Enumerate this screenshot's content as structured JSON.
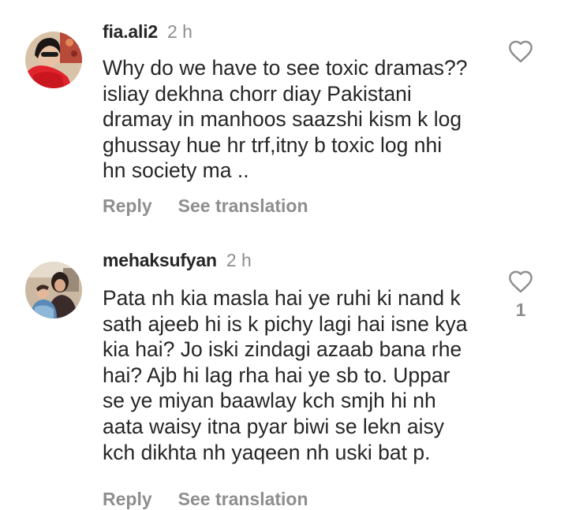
{
  "comments": [
    {
      "username": "fia.ali2",
      "time": "2 h",
      "lines": [
        "Why do we have to see toxic dramas??",
        "isliay dekhna chorr diay Pakistani",
        "dramay in manhoos saazshi kism k log",
        "ghussay hue hr trf,itny b toxic log nhi",
        "hn society ma .."
      ],
      "reply_label": "Reply",
      "translate_label": "See translation",
      "like_count": "",
      "avatar_icon": "user-avatar-red-scarf"
    },
    {
      "username": "mehaksufyan",
      "time": "2 h",
      "lines": [
        "Pata nh kia masla hai ye ruhi ki nand k",
        "sath ajeeb hi is k pichy lagi hai isne kya",
        "kia hai? Jo iski zindagi azaab bana rhe",
        "hai? Ajb hi lag rha hai ye sb to. Uppar",
        "se ye miyan baawlay kch smjh hi nh",
        "aata waisy itna pyar biwi se lekn aisy",
        "kch dikhta nh yaqeen nh uski bat p."
      ],
      "reply_label": "Reply",
      "translate_label": "See translation",
      "like_count": "1",
      "avatar_icon": "user-avatar-mother-child"
    }
  ],
  "colors": {
    "text": "#262626",
    "muted": "#8e8e8e",
    "background": "#ffffff"
  },
  "icons": {
    "like": "heart-outline-icon"
  }
}
